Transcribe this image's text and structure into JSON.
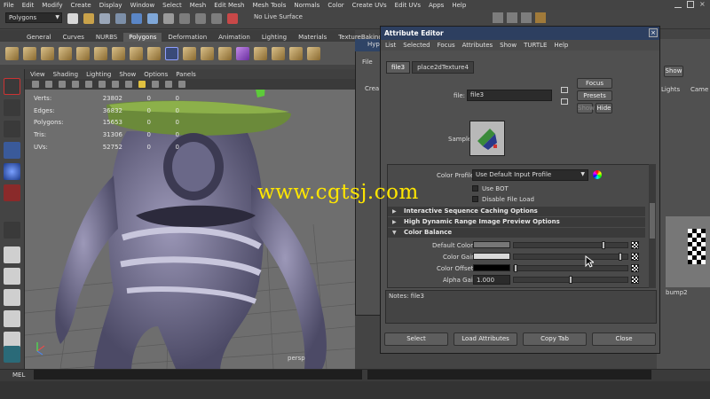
{
  "menubar": [
    "File",
    "Edit",
    "Modify",
    "Create",
    "Display",
    "Window",
    "Select",
    "Mesh",
    "Edit Mesh",
    "Mesh Tools",
    "Normals",
    "Color",
    "Create UVs",
    "Edit UVs",
    "Apps",
    "Help"
  ],
  "toolbar": {
    "mode": "Polygons",
    "live_surface": "No Live Surface"
  },
  "shelf_tabs": [
    "General",
    "Curves",
    "NURBS",
    "Polygons",
    "Deformation",
    "Animation",
    "Lighting",
    "Materials",
    "TextureBaking"
  ],
  "viewport": {
    "menu": [
      "View",
      "Shading",
      "Lighting",
      "Show",
      "Options",
      "Panels"
    ],
    "hud": [
      {
        "label": "Verts:",
        "a": "23802",
        "b": "0",
        "c": "0"
      },
      {
        "label": "Edges:",
        "a": "36832",
        "b": "0",
        "c": "0"
      },
      {
        "label": "Polygons:",
        "a": "15653",
        "b": "0",
        "c": "0"
      },
      {
        "label": "Tris:",
        "a": "31306",
        "b": "0",
        "c": "0"
      },
      {
        "label": "UVs:",
        "a": "52752",
        "b": "0",
        "c": "0"
      }
    ],
    "camera": "persp"
  },
  "hyper_window": {
    "title": "Hyp",
    "file": "File",
    "create": "Crea"
  },
  "right_panel": {
    "show": "Show",
    "lights": "Lights",
    "cameras": "Came",
    "bump": "bump2"
  },
  "attribute_editor": {
    "title": "Attribute Editor",
    "menu": [
      "List",
      "Selected",
      "Focus",
      "Attributes",
      "Show",
      "TURTLE",
      "Help"
    ],
    "tabs": [
      "file3",
      "place2dTexture4"
    ],
    "file_label": "file:",
    "file_value": "file3",
    "focus": "Focus",
    "presets": "Presets",
    "show": "Show",
    "hide": "Hide",
    "sample_label": "Sample",
    "color_profile_label": "Color Profile",
    "color_profile_value": "Use Default Input Profile",
    "use_bot": "Use BOT",
    "disable_file_load": "Disable File Load",
    "sections": {
      "caching": "Interactive Sequence Caching Options",
      "hdr": "High Dynamic Range Image Preview Options",
      "color_balance": "Color Balance"
    },
    "attributes": [
      {
        "label": "Default Color",
        "level": 0.8
      },
      {
        "label": "Color Gain",
        "level": 0.95
      },
      {
        "label": "Color Offset",
        "level": 0.0
      },
      {
        "label": "Alpha Gain",
        "value": "1.000",
        "level": 0.5
      }
    ],
    "notes": "Notes:  file3",
    "buttons": [
      "Select",
      "Load Attributes",
      "Copy Tab",
      "Close"
    ]
  },
  "command": {
    "mel": "MEL"
  },
  "watermark": "www.cgtsj.com",
  "colors": {
    "title_bar": "#2d3f60",
    "watermark": "#ffe600",
    "accent": "#3a4f74"
  }
}
